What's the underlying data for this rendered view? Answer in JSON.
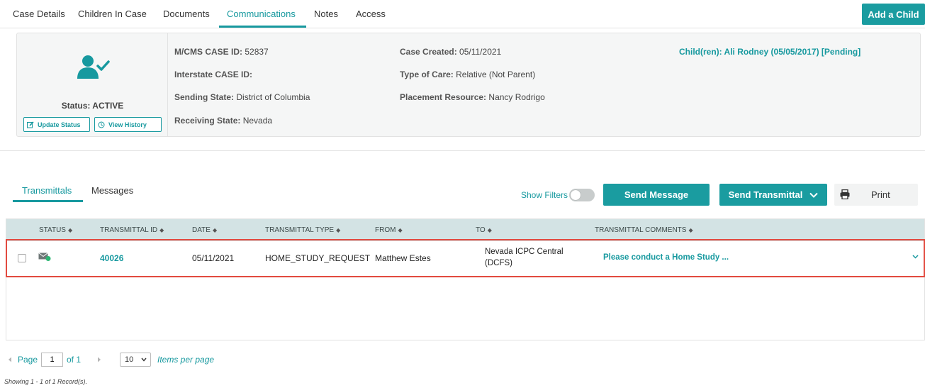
{
  "top_tabs": [
    {
      "label": "Case Details"
    },
    {
      "label": "Children In Case"
    },
    {
      "label": "Documents"
    },
    {
      "label": "Communications",
      "active": true
    },
    {
      "label": "Notes"
    },
    {
      "label": "Access"
    }
  ],
  "add_child_label": "Add a Child",
  "case": {
    "status_label": "Status: ACTIVE",
    "update_status_label": "Update Status",
    "view_history_label": "View History",
    "mcms_case_id_label": "M/CMS CASE ID:",
    "mcms_case_id": "52837",
    "interstate_case_id_label": "Interstate CASE ID:",
    "interstate_case_id": "",
    "sending_state_label": "Sending State:",
    "sending_state": "District of Columbia",
    "receiving_state_label": "Receiving State:",
    "receiving_state": "Nevada",
    "case_created_label": "Case Created:",
    "case_created": "05/11/2021",
    "type_of_care_label": "Type of Care:",
    "type_of_care": "Relative (Not Parent)",
    "placement_resource_label": "Placement Resource:",
    "placement_resource": "Nancy Rodrigo",
    "children_link": "Child(ren): Ali Rodney (05/05/2017) [Pending]"
  },
  "sub_tabs": [
    {
      "label": "Transmittals",
      "active": true
    },
    {
      "label": "Messages"
    }
  ],
  "actions": {
    "show_filters_label": "Show Filters",
    "show_filters_on": false,
    "send_message_label": "Send Message",
    "send_transmittal_label": "Send Transmittal",
    "print_label": "Print"
  },
  "table": {
    "columns": [
      "STATUS",
      "TRANSMITTAL ID",
      "DATE",
      "TRANSMITTAL TYPE",
      "FROM",
      "TO",
      "TRANSMITTAL COMMENTS"
    ],
    "rows": [
      {
        "status_icon": "envelope-sent-icon",
        "transmittal_id": "40026",
        "date": "05/11/2021",
        "transmittal_type": "HOME_STUDY_REQUEST",
        "from": "Matthew Estes",
        "to_line1": "Nevada ICPC Central",
        "to_line2": "(DCFS)",
        "comments": "Please conduct a Home Study ..."
      }
    ]
  },
  "pager": {
    "page_label": "Page",
    "current_page": "1",
    "of_label": "of 1",
    "per_page": "10",
    "items_per_page_label": "Items per page",
    "showing_text": "Showing 1 - 1 of 1 Record(s)."
  },
  "colors": {
    "accent": "#1a9ca0",
    "header_bg": "#d3e3e4",
    "highlight": "#e24a3f"
  }
}
